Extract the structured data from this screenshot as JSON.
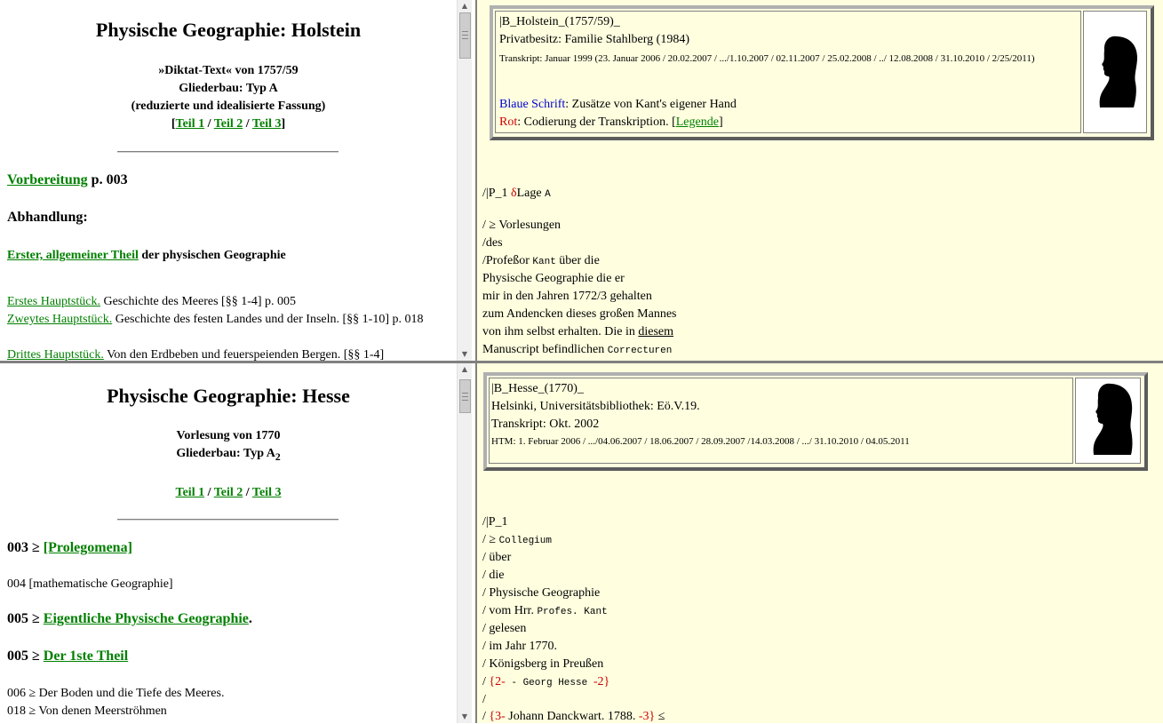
{
  "top_left": {
    "title": "Physische Geographie: Holstein",
    "subtitle1": "»Diktat-Text« von 1757/59",
    "subtitle2": "Gliederbau: Typ A",
    "subtitle3": "(reduzierte und idealisierte Fassung)",
    "teil_links": [
      "Teil 1",
      "Teil 2",
      "Teil 3"
    ],
    "bracket_open": "[",
    "bracket_close": "]",
    "sep": " / ",
    "vorbereitung_link": "Vorbereitung",
    "vorbereitung_page": " p. 003",
    "abhandlung": "Abhandlung:",
    "erster_link": "Erster, allgemeiner Theil",
    "erster_rest": " der physischen Geographie",
    "entries": [
      {
        "link": "Erstes Hauptstück.",
        "text": " Geschichte des Meeres [§§ 1-4] p. 005"
      },
      {
        "link": "Zweytes Hauptstück.",
        "text": " Geschichte des festen Landes und der Inseln. [§§ 1-10] p. 018"
      },
      {
        "link": "Drittes Hauptstück.",
        "text": " Von den Erdbeben und feuerspeienden Bergen. [§§ 1-4]"
      }
    ]
  },
  "top_right": {
    "line1": "|B_Holstein_(1757/59)_",
    "line2": "Privatbesitz: Familie Stahlberg (1984)",
    "line3": "Transkript: Januar 1999 (23. Januar 2006 / 20.02.2007 / .../1.10.2007 / 02.11.2007 / 25.02.2008 / ../ 12.08.2008 / 31.10.2010 / 2/25/2011)",
    "blue_label": "Blaue Schrift",
    "blue_text": ": Zusätze von Kant's eigener Hand",
    "red_label": "Rot",
    "red_text": ": Codierung der Transkription. [",
    "legende_link": "Legende",
    "legende_close": "]",
    "text_lines": {
      "l1_a": "/|P_1 ",
      "l1_delta": "δ",
      "l1_b": "Lage ",
      "l1_mono": "A",
      "l2": "/ ≥ Vorlesungen",
      "l3": "/des",
      "l4_a": "/Profeßor ",
      "l4_mono": "Kant",
      "l4_b": " über die",
      "l5": "Physische Geographie die er",
      "l6": "mir in den Jahren 1772/3 gehalten",
      "l7": "zum Andencken dieses großen Mannes",
      "l8_a": "von ihm selbst erhalten. Die in ",
      "l8_u": "diesem",
      "l9_a": "Manuscript befindlichen ",
      "l9_mono": "Correcturen"
    }
  },
  "bottom_left": {
    "title": "Physische Geographie: Hesse",
    "subtitle1": "Vorlesung von 1770",
    "subtitle2": "Gliederbau: Typ A",
    "subtitle2_sub": "2",
    "teil_links": [
      "Teil 1",
      "Teil 2",
      "Teil 3"
    ],
    "sep": " / ",
    "s1_num": "003 ≥ ",
    "s1_link": "[Prolegomena]",
    "s2": "004 [mathematische Geographie]",
    "s3_num": "005 ≥ ",
    "s3_link": "Eigentliche Physische Geographie",
    "s3_dot": ".",
    "s4_num": "005 ≥ ",
    "s4_link": "Der 1ste Theil",
    "s5": "006 ≥ Der Boden und die Tiefe des Meeres.",
    "s6": "018 ≥ Von denen Meerströhmen"
  },
  "bottom_right": {
    "line1": "|B_Hesse_(1770)_",
    "line2": "Helsinki, Universitätsbibliothek: Eö.V.19.",
    "line3": "Transkript: Okt. 2002",
    "line4": "HTM: 1. Februar 2006 / .../04.06.2007 / 18.06.2007 / 28.09.2007 /14.03.2008 / .../ 31.10.2010 / 04.05.2011",
    "text_lines": {
      "l1": "/|P_1",
      "l2_a": "/ ≥ ",
      "l2_mono": "Collegium",
      "l3": "/ über",
      "l4": "/ die",
      "l5": "/ Physische Geographie",
      "l6_a": "/ vom Hrr. ",
      "l6_mono": "Profes. Kant",
      "l7": "/ gelesen",
      "l8": "/ im Jahr 1770.",
      "l9": "/ Königsberg in Preußen",
      "l10_a": "/ ",
      "l10_r1": "{2-",
      "l10_mono": " - Georg Hesse ",
      "l10_r2": "-2}",
      "l11": "/",
      "l12_a": "/ ",
      "l12_r1": "{3-",
      "l12_b": " Johann Danckwart. 1788. ",
      "l12_r2": "-3}",
      "l12_c": " ≤"
    }
  },
  "colors": {
    "link": "#008000",
    "right_bg": "#ffffe0",
    "blue": "#0000cc",
    "red": "#cc0000"
  }
}
